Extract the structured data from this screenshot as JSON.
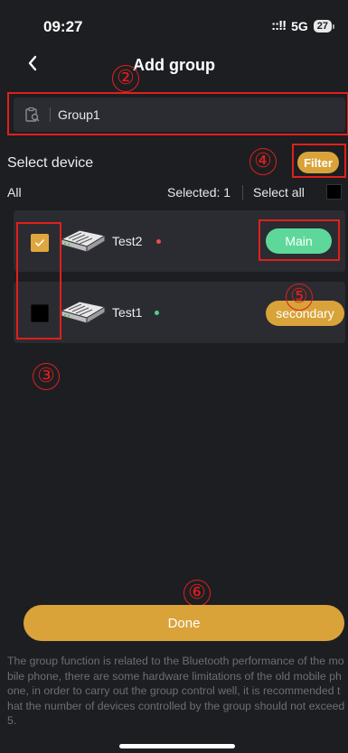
{
  "status_bar": {
    "time": "09:27",
    "signal": "::!!",
    "network": "5G",
    "battery": "27"
  },
  "header": {
    "title": "Add group"
  },
  "group_name": {
    "value": "Group1"
  },
  "select_device": {
    "title": "Select device",
    "filter_label": "Filter",
    "all_label": "All",
    "selected_text": "Selected: 1",
    "select_all_label": "Select all"
  },
  "devices": [
    {
      "name": "Test2",
      "checked": true,
      "status_color": "#e85050",
      "role": "Main"
    },
    {
      "name": "Test1",
      "checked": false,
      "status_color": "#4fcf8a",
      "role": "secondary"
    }
  ],
  "done_label": "Done",
  "note": "The group function is related to the Bluetooth performance of the mobile phone, there are some hardware limitations of the old mobile phone, in order to carry out the group control well, it is recommended that the number of devices controlled by the group should not exceed 5.",
  "annotations": [
    "②",
    "③",
    "④",
    "⑤",
    "⑥"
  ],
  "colors": {
    "accent": "#d9a33a",
    "main_role": "#5ed89a",
    "background": "#1d1e22",
    "card": "#2b2c31",
    "annotation": "#e0201c"
  }
}
